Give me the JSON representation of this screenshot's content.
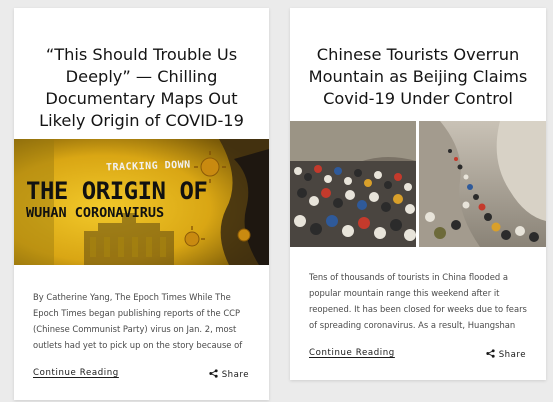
{
  "articles": [
    {
      "title": "“This Should Trouble Us Deeply” — Chilling Documentary Maps Out Likely Origin of COVID-19",
      "image": {
        "overlay_small": "TRACKING DOWN",
        "overlay_main": "THE ORIGIN OF",
        "overlay_sub": "WUHAN CORONAVIRUS"
      },
      "excerpt": "By Catherine Yang, The Epoch Times While The Epoch Times began publishing reports of the CCP (Chinese Communist Party) virus on Jan. 2, most outlets had yet to pick up on the story because of the CCP’s lockdown on",
      "continue_label": "Continue Reading",
      "share_label": "Share"
    },
    {
      "title": "Chinese Tourists Overrun Mountain as Beijing Claims Covid-19 Under Control",
      "excerpt": "Tens of thousands of tourists in China flooded a popular mountain range this weekend after it reopened. It has been closed for weeks due to fears of spreading coronavirus. As a result, Huangshan also known as the",
      "continue_label": "Continue Reading",
      "share_label": "Share"
    }
  ],
  "colors": {
    "page_background": "#ebebeb",
    "card_background": "#ffffff",
    "title": "#141414",
    "excerpt": "#4a4a4a",
    "origin_image_yellow": "#e8b818"
  },
  "icons": {
    "share": "share-icon"
  }
}
